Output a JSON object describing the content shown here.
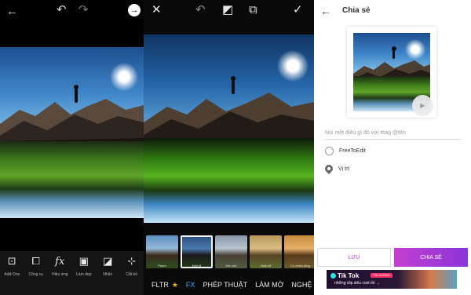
{
  "panel1": {
    "icons": {
      "back": "back-arrow-icon",
      "undo": "undo-icon",
      "redo": "redo-icon",
      "next": "next-arrow-icon"
    },
    "tools": [
      {
        "label": "Add-Ons",
        "icon": "shopping-bag-icon",
        "glyph": "⊡"
      },
      {
        "label": "Công cụ",
        "icon": "crop-icon",
        "glyph": "⧠"
      },
      {
        "label": "Hiệu ứng",
        "icon": "effects-fx-icon",
        "glyph": "fx"
      },
      {
        "label": "Làm đẹp",
        "icon": "beautify-icon",
        "glyph": "▣"
      },
      {
        "label": "Nhãn",
        "icon": "sticker-icon",
        "glyph": "◪"
      },
      {
        "label": "Cắt bỏ",
        "icon": "cutout-icon",
        "glyph": "⊹"
      }
    ]
  },
  "panel2": {
    "icons": {
      "close": "close-icon",
      "undo": "undo-icon",
      "eraser": "eraser-icon",
      "compare": "compare-icon",
      "apply": "checkmark-icon"
    },
    "thumbnails": [
      {
        "label": "Pham"
      },
      {
        "label": "Nhỏ lỏ"
      },
      {
        "label": "Mơ ước"
      },
      {
        "label": "Hoài cổ"
      },
      {
        "label": "Có nhiều tầng"
      }
    ],
    "categories": [
      {
        "label": "FLTR"
      },
      {
        "label": "FX"
      },
      {
        "label": "PHÉP THUẬT"
      },
      {
        "label": "LÀM MỜ"
      },
      {
        "label": "NGHỆ"
      }
    ]
  },
  "panel3": {
    "title": "Chia sẻ",
    "caption_placeholder": "Nói một điều gì đó với #tag @tên",
    "option_free_to_edit": "FreeToEdit",
    "option_location": "Vị trí",
    "save_label": "LƯU",
    "share_label": "CHIA SẺ",
    "ad": {
      "brand": "Tik Tok",
      "badge": "TẢI XUỐNG",
      "tagline": "những clip siêu cool rồi →"
    }
  },
  "colors": {
    "fx_active": "#31a7ff",
    "share_gradient_start": "#c43fd0",
    "share_gradient_end": "#8a35d8",
    "save_text": "#b637c9",
    "star": "#f2b50f"
  }
}
